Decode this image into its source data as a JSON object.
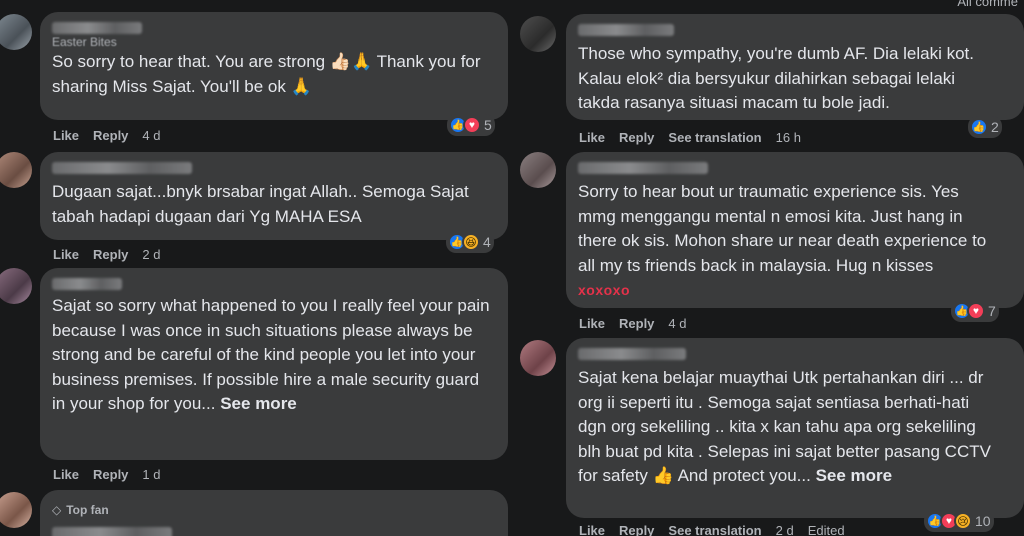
{
  "top_right_partial": "All comme",
  "left": [
    {
      "name_partial": "Easter Bites",
      "text": "So sorry to hear that. You are strong 👍🏻🙏 Thank you for sharing Miss Sajat. You'll be ok 🙏",
      "actions": {
        "like": "Like",
        "reply": "Reply",
        "time": "4 d"
      },
      "reactions": {
        "count": "5"
      }
    },
    {
      "text": "Dugaan sajat...bnyk brsabar ingat Allah.. Semoga Sajat tabah hadapi dugaan dari Yg MAHA ESA",
      "actions": {
        "like": "Like",
        "reply": "Reply",
        "time": "2 d"
      },
      "reactions": {
        "count": "4"
      }
    },
    {
      "text": "Sajat so sorry what happened to you I really feel your pain because I was once in such situations please always be strong and be careful of the kind people you let into your business premises. If possible hire a male security guard in your shop for you...",
      "see_more": "See more",
      "actions": {
        "like": "Like",
        "reply": "Reply",
        "time": "1 d"
      }
    },
    {
      "badge": "Top fan"
    }
  ],
  "right": [
    {
      "text": "Those who sympathy, you're dumb AF. Dia lelaki kot. Kalau elok² dia bersyukur dilahirkan sebagai lelaki takda rasanya situasi macam tu bole jadi.",
      "actions": {
        "like": "Like",
        "reply": "Reply",
        "translate": "See translation",
        "time": "16 h"
      },
      "reactions": {
        "count": "2"
      }
    },
    {
      "text": "Sorry to hear bout ur traumatic experience sis. Yes mmg menggangu mental n emosi kita. Just hang in there ok sis. Mohon share ur near death experience to all my ts friends back in malaysia. Hug n kisses",
      "extra": "xoxoxo",
      "actions": {
        "like": "Like",
        "reply": "Reply",
        "time": "4 d"
      },
      "reactions": {
        "count": "7"
      }
    },
    {
      "text": "Sajat kena belajar muaythai Utk pertahankan diri ... dr org ii seperti itu . Semoga sajat sentiasa berhati-hati dgn org sekeliling .. kita x kan tahu apa org sekeliling blh buat pd kita . Selepas ini sajat better pasang CCTV for safety 👍 And protect you...",
      "see_more": "See more",
      "actions": {
        "like": "Like",
        "reply": "Reply",
        "translate": "See translation",
        "time": "2 d",
        "edited": "Edited"
      },
      "reactions": {
        "count": "10"
      }
    }
  ]
}
